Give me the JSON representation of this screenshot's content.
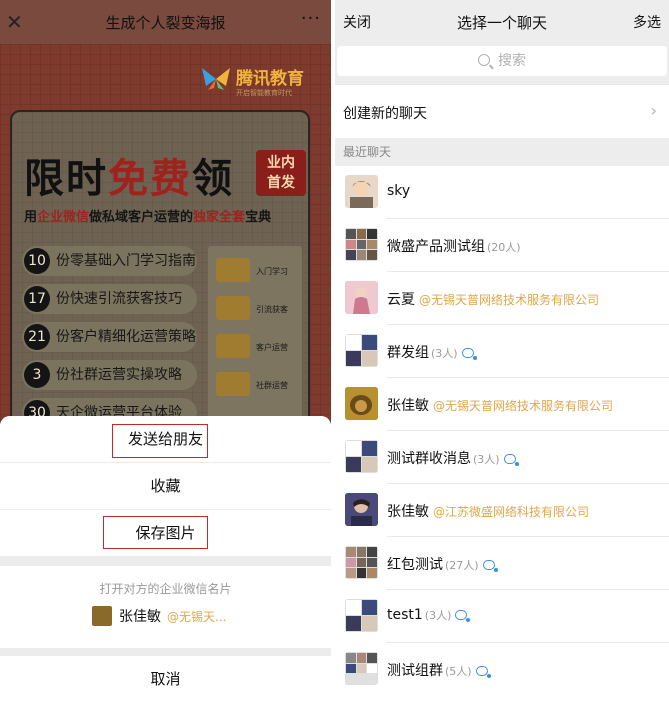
{
  "left": {
    "title": "生成个人裂变海报",
    "close_glyph": "✕",
    "more_glyph": "···",
    "poster": {
      "brand": "腾讯教育",
      "brand_sub": "开启智能教育时代",
      "headline_a": "限时",
      "headline_b": "免费",
      "headline_c": "领",
      "badge_1": "业内",
      "badge_2": "首发",
      "tagline_a": "用",
      "tagline_b": "企业微信",
      "tagline_c": "做私域客户运营的",
      "tagline_d": "独家全套",
      "tagline_e": "宝典",
      "items": [
        {
          "num": "10",
          "text": "份零基础入门学习指南"
        },
        {
          "num": "17",
          "text": "份快速引流获客技巧"
        },
        {
          "num": "21",
          "text": "份客户精细化运营策略"
        },
        {
          "num": "3",
          "text": "份社群运营实操攻略"
        },
        {
          "num": "30",
          "text": "天企微运营平台体验"
        }
      ],
      "folders": [
        "入门学习",
        "引流获客",
        "客户运营",
        "社群运营"
      ]
    },
    "sheet": {
      "send_label": "发送给朋友",
      "fav_label": "收藏",
      "save_label": "保存图片",
      "card_hint": "打开对方的企业微信名片",
      "card_name": "张佳敏",
      "card_company": "@无锡天...",
      "cancel_label": "取消"
    }
  },
  "right": {
    "close_label": "关闭",
    "title": "选择一个聊天",
    "multi_label": "多选",
    "search_placeholder": "搜索",
    "create_label": "创建新的聊天",
    "section_label": "最近聊天",
    "chats": [
      {
        "name": "sky",
        "count": "",
        "company": "",
        "group": false
      },
      {
        "name": "微盛产品测试组",
        "count": "(20人)",
        "company": "",
        "group": true
      },
      {
        "name": "云夏",
        "count": "",
        "company": "@无锡天普网络技术服务有限公司",
        "group": false
      },
      {
        "name": "群发组",
        "count": "(3人)",
        "company": "",
        "group": true
      },
      {
        "name": "张佳敏",
        "count": "",
        "company": "@无锡天普网络技术服务有限公司",
        "group": false
      },
      {
        "name": "测试群收消息",
        "count": "(3人)",
        "company": "",
        "group": true
      },
      {
        "name": "张佳敏",
        "count": "",
        "company": "@江苏微盛网络科技有限公司",
        "group": false
      },
      {
        "name": "红包测试",
        "count": "(27人)",
        "company": "",
        "group": true
      },
      {
        "name": "test1",
        "count": "(3人)",
        "company": "",
        "group": true
      },
      {
        "name": "测试组群",
        "count": "(5人)",
        "company": "",
        "group": true
      }
    ]
  }
}
